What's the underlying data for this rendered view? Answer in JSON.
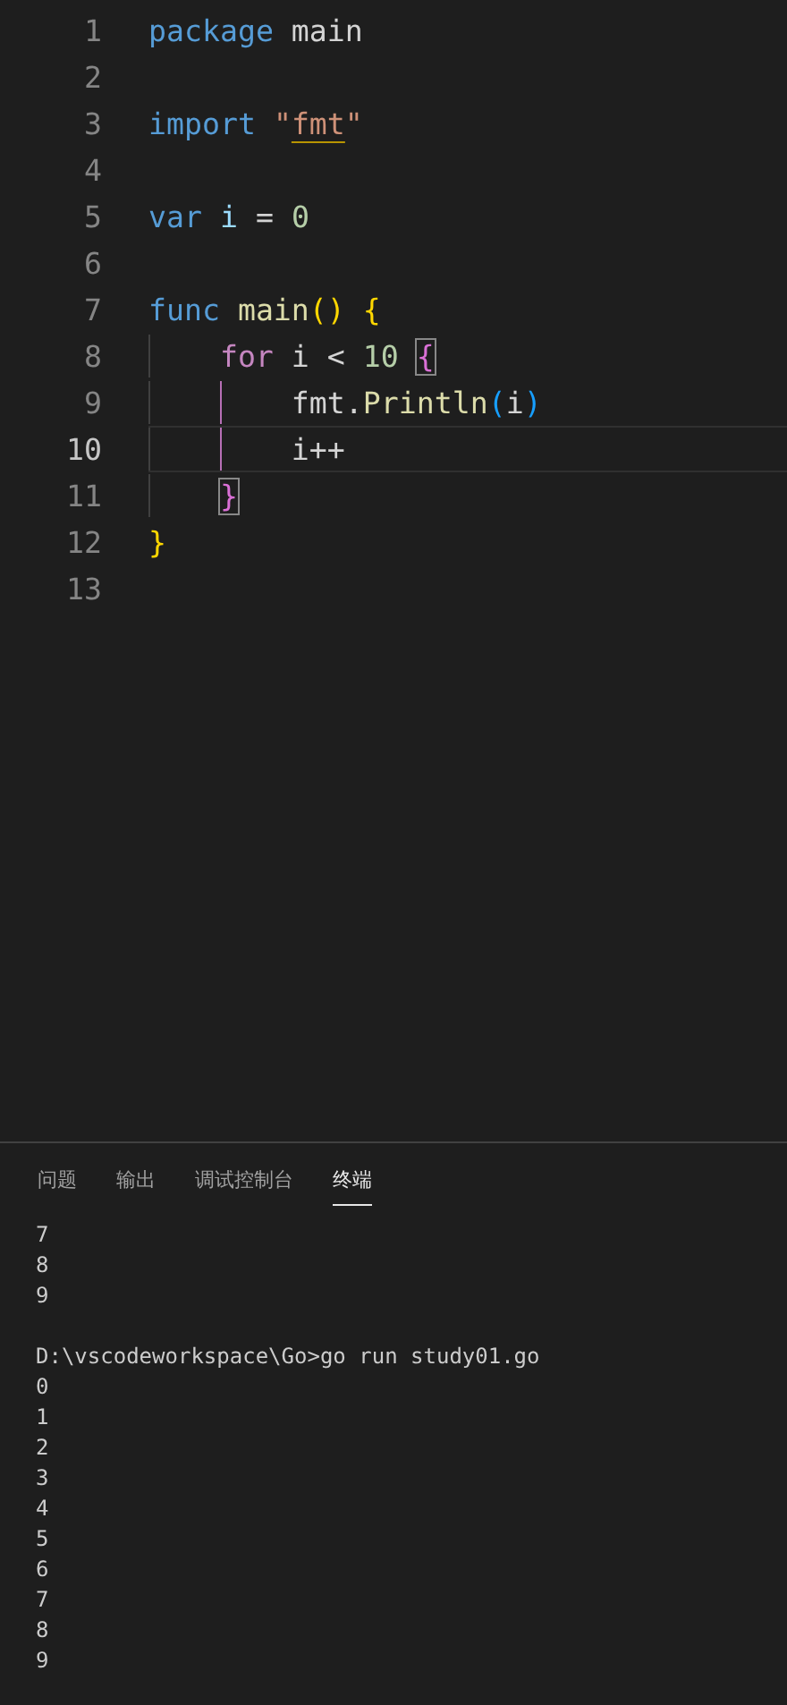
{
  "editor": {
    "lines": [
      {
        "number": "1",
        "active": false,
        "tokens": [
          {
            "kind": "keyword",
            "text": "package"
          },
          {
            "kind": "plain",
            "text": " main"
          }
        ]
      },
      {
        "number": "2",
        "active": false
      },
      {
        "number": "3",
        "active": false,
        "tokens": [
          {
            "kind": "keyword",
            "text": "import "
          },
          {
            "kind": "string",
            "text": "\""
          },
          {
            "kind": "string-warning",
            "text": "fmt"
          },
          {
            "kind": "string",
            "text": "\""
          }
        ]
      },
      {
        "number": "4",
        "active": false
      },
      {
        "number": "5",
        "active": false,
        "tokens": [
          {
            "kind": "keyword",
            "text": "var "
          },
          {
            "kind": "variable",
            "text": "i"
          },
          {
            "kind": "plain",
            "text": " = "
          },
          {
            "kind": "number",
            "text": "0"
          }
        ]
      },
      {
        "number": "6",
        "active": false
      },
      {
        "number": "7",
        "active": false,
        "tokens": [
          {
            "kind": "keyword",
            "text": "func "
          },
          {
            "kind": "function",
            "text": "main"
          },
          {
            "kind": "bracket-1",
            "text": "() {"
          }
        ]
      },
      {
        "number": "8",
        "active": false,
        "tokens": [
          {
            "kind": "guide"
          },
          {
            "kind": "control",
            "text": "for"
          },
          {
            "kind": "plain",
            "text": " i < "
          },
          {
            "kind": "number",
            "text": "10 "
          },
          {
            "kind": "bracket-2-match",
            "text": "{"
          }
        ]
      },
      {
        "number": "9",
        "active": false,
        "tokens": [
          {
            "kind": "guide"
          },
          {
            "kind": "guide-active"
          },
          {
            "kind": "plain",
            "text": "fmt."
          },
          {
            "kind": "function",
            "text": "Println"
          },
          {
            "kind": "bracket-3",
            "text": "("
          },
          {
            "kind": "plain",
            "text": "i"
          },
          {
            "kind": "bracket-3",
            "text": ")"
          }
        ]
      },
      {
        "number": "10",
        "active": true,
        "tokens": [
          {
            "kind": "guide"
          },
          {
            "kind": "guide-active"
          },
          {
            "kind": "plain",
            "text": "i++"
          }
        ]
      },
      {
        "number": "11",
        "active": false,
        "tokens": [
          {
            "kind": "guide"
          },
          {
            "kind": "bracket-2-match",
            "text": "}"
          }
        ]
      },
      {
        "number": "12",
        "active": false,
        "tokens": [
          {
            "kind": "bracket-1",
            "text": "}"
          }
        ]
      },
      {
        "number": "13",
        "active": false
      }
    ]
  },
  "panel": {
    "tabs": [
      {
        "label": "问题",
        "selected": false
      },
      {
        "label": "输出",
        "selected": false
      },
      {
        "label": "调试控制台",
        "selected": false
      },
      {
        "label": "终端",
        "selected": true
      }
    ],
    "terminal": [
      {
        "lines": [
          "7",
          "8",
          "9"
        ]
      },
      {
        "lines": [
          "D:\\vscodeworkspace\\Go>go run study01.go",
          "0",
          "1",
          "2",
          "3",
          "4",
          "5",
          "6",
          "7",
          "8",
          "9"
        ]
      }
    ]
  }
}
